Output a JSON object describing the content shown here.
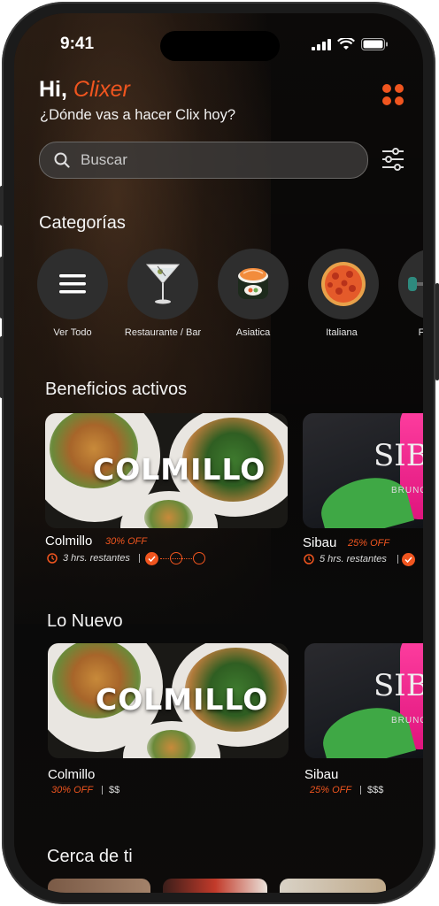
{
  "status": {
    "time": "9:41"
  },
  "header": {
    "greeting": "Hi, ",
    "user_name": "Clixer",
    "subtitle": "¿Dónde vas a hacer Clix hoy?"
  },
  "search": {
    "placeholder": "Buscar"
  },
  "categories": {
    "title": "Categorías",
    "items": [
      {
        "label": "Ver Todo",
        "icon": "menu-icon"
      },
      {
        "label": "Restaurante / Bar",
        "icon": "cocktail-icon"
      },
      {
        "label": "Asiatica",
        "icon": "sushi-icon"
      },
      {
        "label": "Italiana",
        "icon": "pizza-icon"
      },
      {
        "label": "F",
        "icon": "fitness-icon"
      }
    ]
  },
  "beneficios": {
    "title": "Beneficios activos",
    "cards": [
      {
        "name": "Colmillo",
        "logo": "COLMILLO",
        "discount": "30% OFF",
        "remaining": "3 hrs. restantes"
      },
      {
        "name": "Sibau",
        "logo": "SIB",
        "logo_sub": "BRUNCH",
        "discount": "25% OFF",
        "remaining": "5 hrs. restantes"
      }
    ]
  },
  "nuevo": {
    "title": "Lo Nuevo",
    "cards": [
      {
        "name": "Colmillo",
        "logo": "COLMILLO",
        "discount": "30% OFF",
        "price": "$$"
      },
      {
        "name": "Sibau",
        "logo": "SIB",
        "logo_sub": "BRUNCH",
        "discount": "25% OFF",
        "price": "$$$"
      }
    ]
  },
  "cerca": {
    "title": "Cerca de ti"
  },
  "colors": {
    "accent": "#f0551f",
    "background": "#0d0b0a"
  }
}
